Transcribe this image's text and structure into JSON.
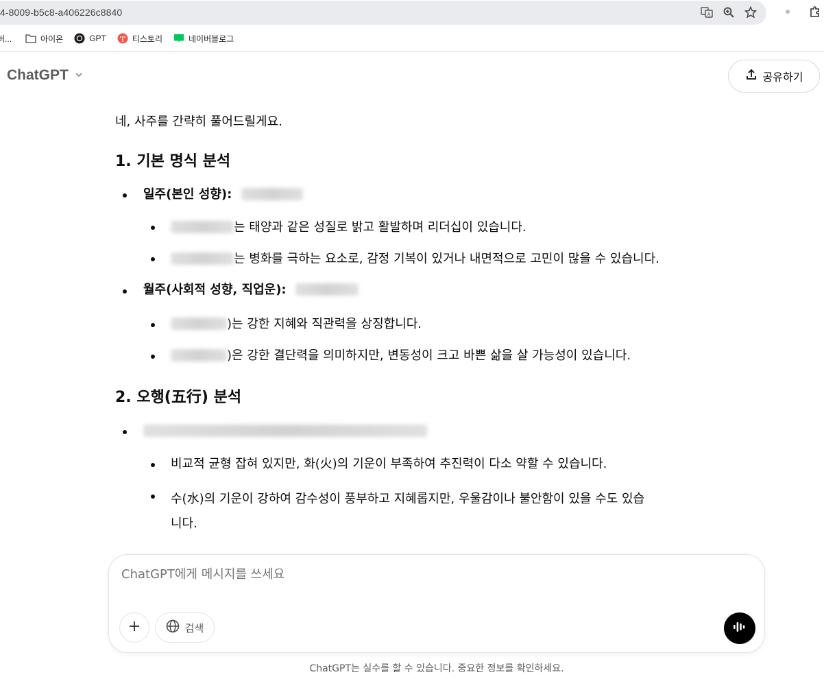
{
  "browser": {
    "url": "4-8009-b5c8-a406226c8840",
    "bookmarks": [
      {
        "label": "버..."
      },
      {
        "label": "아이온"
      },
      {
        "label": "GPT"
      },
      {
        "label": "티스토리"
      },
      {
        "label": "네이버블로그"
      }
    ],
    "naver_badge": "blog"
  },
  "header": {
    "title": "ChatGPT",
    "share_label": "공유하기"
  },
  "message": {
    "intro": "네, 사주를 간략히 풀어드릴게요.",
    "h1": "1. 기본 명식 분석",
    "day_label": "일주(본인 성향):",
    "day_sub1_suffix": "는 태양과 같은 성질로 밝고 활발하며 리더십이 있습니다.",
    "day_sub2_suffix": "는 병화를 극하는 요소로, 감정 기복이 있거나 내면적으로 고민이 많을 수 있습니다.",
    "month_label": "월주(사회적 성향, 직업운):",
    "month_sub1_suffix": ")는 강한 지혜와 직관력을 상징합니다.",
    "month_sub2_suffix": ")은 강한 결단력을 의미하지만, 변동성이 크고 바쁜 삶을 살 가능성이 있습니다.",
    "h2": "2. 오행(五行) 분석",
    "elem_sub1": "비교적 균형 잡혀 있지만, 화(火)의 기운이 부족하여 추진력이 다소 약할 수 있습니다.",
    "elem_sub2_line1": "수(水)의 기운이 강하여 감수성이 풍부하고 지혜롭지만, 우울감이나 불안함이 있을 수도 있습",
    "elem_sub2_line2": "니다."
  },
  "composer": {
    "placeholder": "ChatGPT에게 메시지를 쓰세요",
    "search_label": "검색"
  },
  "footer": {
    "disclaimer": "ChatGPT는 실수를 할 수 있습니다. 중요한 정보를 확인하세요."
  }
}
